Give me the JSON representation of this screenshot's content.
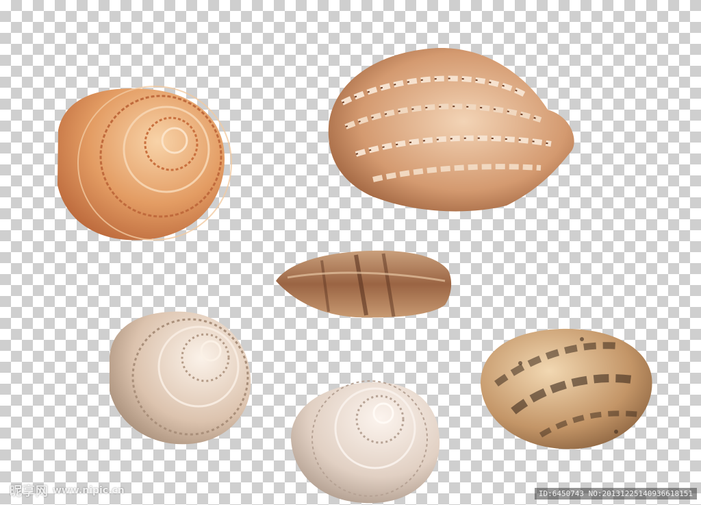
{
  "background": {
    "pattern": "transparency-checkerboard",
    "light": "#ffffff",
    "dark": "#cfcfcf"
  },
  "shells": [
    {
      "name": "sundial-shell",
      "colors": [
        "#f3b07a",
        "#d98a50",
        "#b86438"
      ]
    },
    {
      "name": "harp-shell",
      "colors": [
        "#f0c9a6",
        "#c88b62",
        "#6b3a20"
      ]
    },
    {
      "name": "olive-shell",
      "colors": [
        "#d9ab85",
        "#a06843",
        "#5a3320"
      ]
    },
    {
      "name": "pearly-top-shell",
      "colors": [
        "#f4e6da",
        "#d7bea8",
        "#a98f7a"
      ]
    },
    {
      "name": "white-top-shell",
      "colors": [
        "#f6ebe3",
        "#dccbbd",
        "#b6a294"
      ]
    },
    {
      "name": "spotted-cowrie-shell",
      "colors": [
        "#e7c79a",
        "#b58856",
        "#3c2a1c"
      ]
    }
  ],
  "watermark": {
    "brand": "昵享网",
    "url": "www.nipic.cn",
    "id_text": "ID:6450743 NO:20131225140936618151"
  }
}
